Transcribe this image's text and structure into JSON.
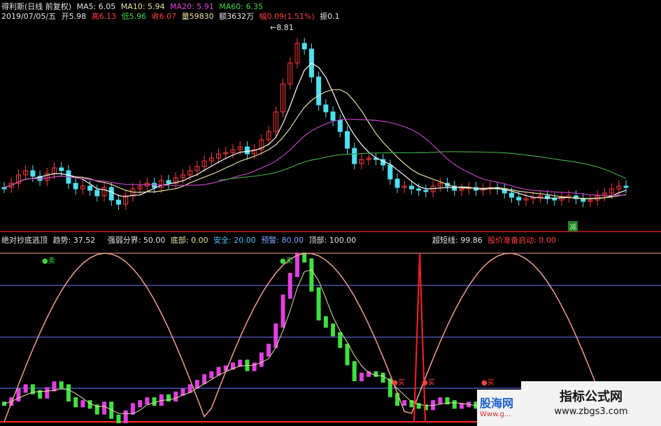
{
  "header": {
    "row1": {
      "name": "得利斯(日线 前复权)",
      "ma5": "MA5: 6.05",
      "ma10": "MA10: 5.94",
      "ma20": "MA20: 5.91",
      "ma60": "MA60: 6.35"
    },
    "row2": {
      "date": "2019/07/05/五",
      "open": "开5.98",
      "high": "高6.13",
      "low": "低5.96",
      "close": "收6.07",
      "volume": "量59830",
      "amount": "额3632万",
      "change": "幅0.09(1.51%)",
      "amplitude": "振0.1"
    }
  },
  "price_panel": {
    "peak_label": "8.81",
    "reduce_marker": "减"
  },
  "indicator": {
    "title": "绝对抄底逃顶",
    "trend": "趋势: 37.52",
    "boundary": "强弱分界: 50.00",
    "bottom": "底部: 0.00",
    "safe": "安全: 20.00",
    "warning": "预警: 80.00",
    "top": "顶部: 100.00",
    "super_short": "超短线: 99.86",
    "price_ready": "股价准备启动: 0.00",
    "sell_label": "卖",
    "buy_label": "买"
  },
  "watermark": {
    "right_line1": "指标公式网",
    "right_line2": "www.zbgs3.com",
    "left_text": "股海网",
    "left_url": "Www.g..."
  },
  "colors": {
    "up": "#ff3b3b",
    "down": "#4fe0f0",
    "ma5": "#ffffff",
    "ma10": "#e8e0a0",
    "ma20": "#c040c0",
    "ma60": "#40a040",
    "bar_up": "#e040e0",
    "bar_down": "#40e040",
    "line_pink": "#f0a090"
  }
}
